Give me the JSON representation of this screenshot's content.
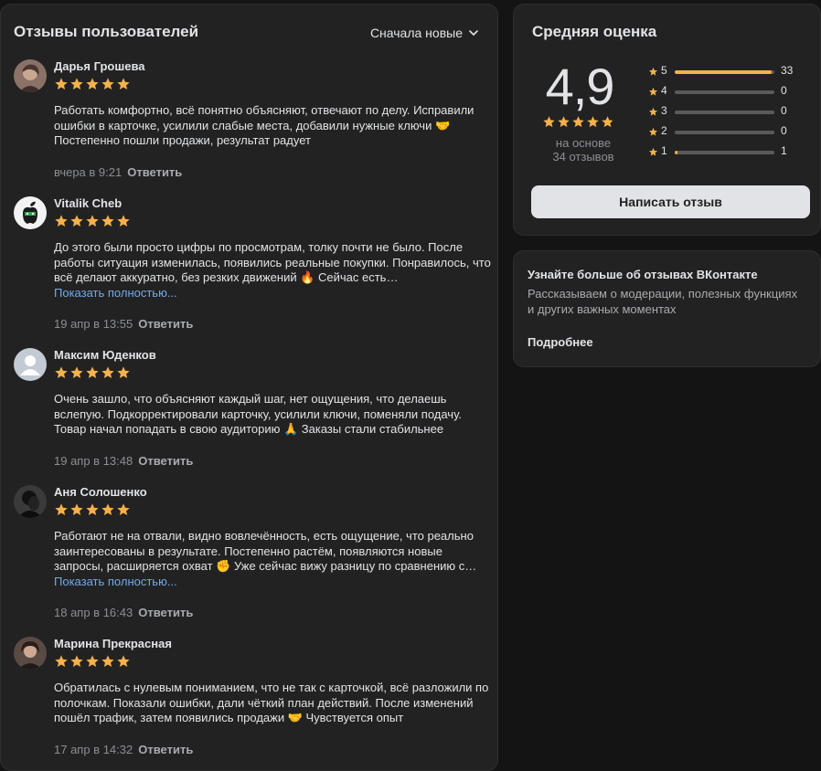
{
  "reviews_panel": {
    "title": "Отзывы пользователей",
    "sort_label": "Сначала новые",
    "reply_label": "Ответить",
    "items": [
      {
        "name": "Дарья Грошева",
        "stars": 5,
        "text": "Работать комфортно, всё понятно объясняют, отвечают по делу. Исправили ошибки в карточке, усилили слабые места, добавили нужные ключи 🤝 Постепенно пошли продажи, результат радует",
        "more": "",
        "date": "вчера в 9:21"
      },
      {
        "name": "Vitalik Cheb",
        "stars": 5,
        "text": "До этого были просто цифры по просмотрам, толку почти не было. После работы ситуация изменилась, появились реальные покупки. Понравилось, что всё делают аккуратно, без резких движений 🔥 Сейчас есть…",
        "more": "Показать полностью...",
        "date": "19 апр в 13:55"
      },
      {
        "name": "Максим Юденков",
        "stars": 5,
        "text": "Очень зашло, что объясняют каждый шаг, нет ощущения, что делаешь вслепую. Подкорректировали карточку, усилили ключи, поменяли подачу. Товар начал попадать в свою аудиторию 🙏 Заказы стали стабильнее",
        "more": "",
        "date": "19 апр в 13:48"
      },
      {
        "name": "Аня Солошенко",
        "stars": 5,
        "text": "Работают не на отвали, видно вовлечённость, есть ощущение, что реально заинтересованы в результате. Постепенно растём, появляются новые запросы, расширяется охват ✊ Уже сейчас вижу разницу по сравнению с…",
        "more": "Показать полностью...",
        "date": "18 апр в 16:43"
      },
      {
        "name": "Марина Прекрасная",
        "stars": 5,
        "text": "Обратилась с нулевым пониманием, что не так с карточкой, всё разложили по полочкам. Показали ошибки, дали чёткий план действий. После изменений пошёл трафик, затем появились продажи 🤝 Чувствуется опыт",
        "more": "",
        "date": "17 апр в 14:32"
      }
    ]
  },
  "rating_panel": {
    "title": "Средняя оценка",
    "average": "4,9",
    "average_stars": 4.9,
    "based_on_line1": "на основе",
    "based_on_line2": "34 отзывов",
    "distribution": [
      {
        "label": "5",
        "count": "33",
        "fraction": 0.97
      },
      {
        "label": "4",
        "count": "0",
        "fraction": 0
      },
      {
        "label": "3",
        "count": "0",
        "fraction": 0
      },
      {
        "label": "2",
        "count": "0",
        "fraction": 0
      },
      {
        "label": "1",
        "count": "1",
        "fraction": 0.03
      }
    ],
    "write_button": "Написать отзыв"
  },
  "info_panel": {
    "title": "Узнайте больше об отзывах ВКонтакте",
    "text": "Рассказываем о модерации, полезных функциях и других важных моментах",
    "link": "Подробнее"
  },
  "colors": {
    "star": "#f5b14a",
    "link": "#71aaeb",
    "panel": "#222222",
    "background": "#141414"
  }
}
